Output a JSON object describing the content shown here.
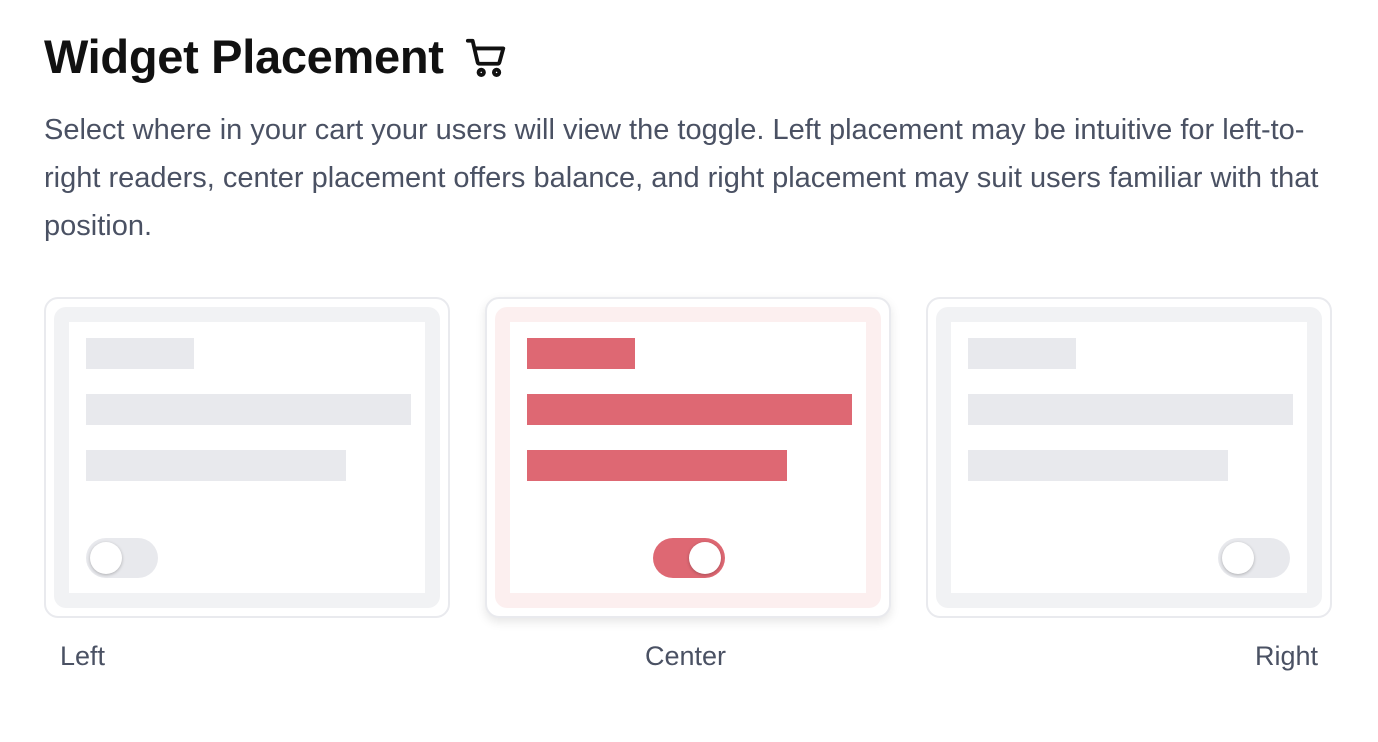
{
  "header": {
    "title": "Widget Placement",
    "icon": "cart-icon",
    "description": "Select where in your cart your users will view the toggle. Left placement may be intuitive for left-to-right readers, center placement offers balance, and right placement may suit users familiar with that position."
  },
  "options": [
    {
      "label": "Left",
      "selected": false,
      "toggle_on": false
    },
    {
      "label": "Center",
      "selected": true,
      "toggle_on": true
    },
    {
      "label": "Right",
      "selected": false,
      "toggle_on": false
    }
  ],
  "colors": {
    "accent": "#de6873",
    "accent_tint": "#fcefef",
    "placeholder": "#e8e9ed",
    "frame": "#f1f2f4",
    "text_muted": "#4a5163",
    "title": "#111111"
  }
}
